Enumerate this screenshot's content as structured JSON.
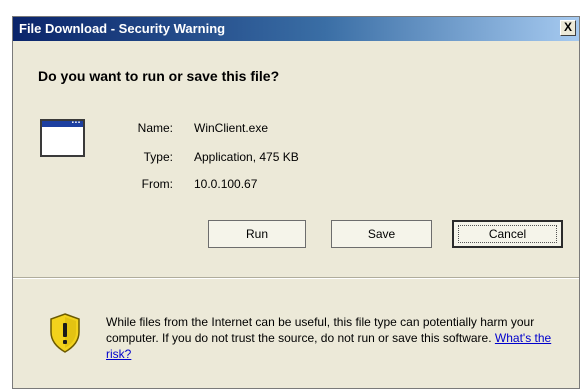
{
  "window": {
    "title": "File Download - Security Warning",
    "close_glyph": "X"
  },
  "question": "Do you want to run or save this file?",
  "file": {
    "icon": "application-window-icon",
    "name_label": "Name:",
    "name_value": "WinClient.exe",
    "type_label": "Type:",
    "type_value": "Application, 475 KB",
    "from_label": "From:",
    "from_value": "10.0.100.67"
  },
  "buttons": {
    "run": "Run",
    "save": "Save",
    "cancel": "Cancel"
  },
  "warning": {
    "icon": "security-shield-icon",
    "text": "While files from the Internet can be useful, this file type can potentially harm your computer. If you do not trust the source, do not run or save this software.",
    "link": "What's the risk?"
  },
  "colors": {
    "title_bar_start": "#0a246a",
    "title_bar_end": "#a6caf0",
    "dialog_bg": "#ece9d8",
    "link": "#0000cc",
    "shield_yellow": "#f2d21c"
  }
}
